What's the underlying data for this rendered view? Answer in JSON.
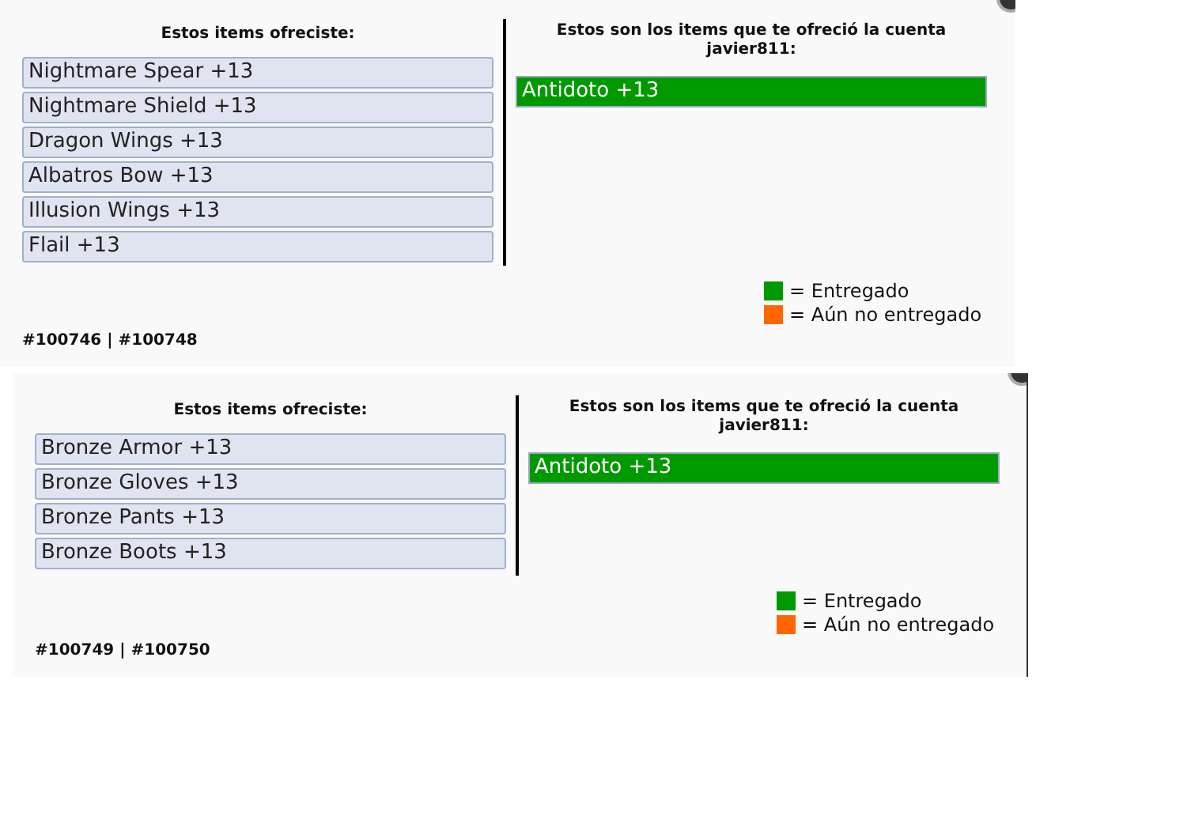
{
  "trades": [
    {
      "my_heading": "Estos items ofreciste:",
      "my_items": [
        {
          "name": "Nightmare Spear +13"
        },
        {
          "name": "Nightmare Shield +13"
        },
        {
          "name": "Dragon Wings +13"
        },
        {
          "name": "Albatros Bow +13"
        },
        {
          "name": "Illusion Wings +13"
        },
        {
          "name": "Flail +13"
        }
      ],
      "their_heading": "Estos son los items que te ofreció la cuenta javier811:",
      "their_items": [
        {
          "name": "Antidoto +13",
          "color": "#009900"
        }
      ],
      "legend": [
        {
          "label": "= Entregado",
          "color": "#009900"
        },
        {
          "label": "= Aún no entregado",
          "color": "#ff6600"
        }
      ],
      "ids": "#100746 | #100748"
    },
    {
      "my_heading": "Estos items ofreciste:",
      "my_items": [
        {
          "name": "Bronze Armor +13"
        },
        {
          "name": "Bronze Gloves +13"
        },
        {
          "name": "Bronze Pants +13"
        },
        {
          "name": "Bronze Boots +13"
        }
      ],
      "their_heading": "Estos son los items que te ofreció la cuenta javier811:",
      "their_items": [
        {
          "name": "Antidoto +13",
          "color": "#009900"
        }
      ],
      "legend": [
        {
          "label": "= Entregado",
          "color": "#009900"
        },
        {
          "label": "= Aún no entregado",
          "color": "#ff6600"
        }
      ],
      "ids": "#100749 | #100750"
    }
  ]
}
